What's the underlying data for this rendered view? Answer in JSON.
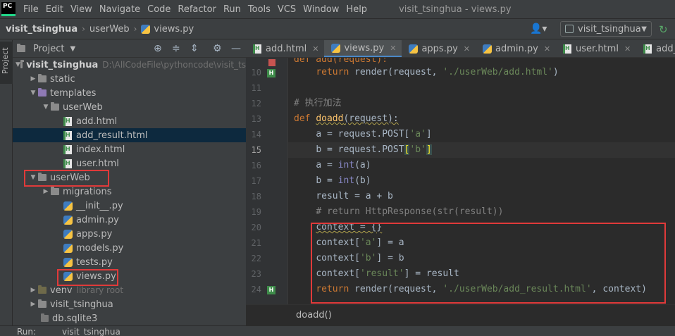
{
  "app": {
    "logo_text": "PC",
    "window_title": "visit_tsinghua - views.py"
  },
  "menu": [
    "File",
    "Edit",
    "View",
    "Navigate",
    "Code",
    "Refactor",
    "Run",
    "Tools",
    "VCS",
    "Window",
    "Help"
  ],
  "navbar": {
    "crumbs": [
      "visit_tsinghua",
      "userWeb",
      "views.py"
    ],
    "run_config": "visit_tsinghua"
  },
  "project_panel": {
    "title": "Project"
  },
  "tree": {
    "root": "visit_tsinghua",
    "root_path": "D:\\AllCodeFile\\pythoncode\\visit_ts",
    "static": "static",
    "templates": "templates",
    "tpl_userweb": "userWeb",
    "add_html": "add.html",
    "add_result_html": "add_result.html",
    "index_html": "index.html",
    "user_html": "user.html",
    "userweb": "userWeb",
    "migrations": "migrations",
    "init_py": "__init__.py",
    "admin_py": "admin.py",
    "apps_py": "apps.py",
    "models_py": "models.py",
    "tests_py": "tests.py",
    "views_py": "views.py",
    "venv": "venv",
    "venv_hint": "library root",
    "visit_pkg": "visit_tsinghua",
    "db": "db.sqlite3"
  },
  "tabs": [
    {
      "label": "add.html",
      "icon": "html"
    },
    {
      "label": "views.py",
      "icon": "py"
    },
    {
      "label": "apps.py",
      "icon": "py"
    },
    {
      "label": "admin.py",
      "icon": "py"
    },
    {
      "label": "user.html",
      "icon": "html"
    },
    {
      "label": "add_result.html",
      "icon": "html"
    }
  ],
  "code": {
    "l9": "def add(request):",
    "l10_kw": "return",
    "l10_a": " render(request, ",
    "l10_str": "'./userWeb/add.html'",
    "l10_b": ")",
    "l12": "# 执行加法",
    "l13_kw": "def",
    "l13_fn": "doadd",
    "l13_rest": "(request):",
    "l14_a": "a = request.POST[",
    "l14_str": "'a'",
    "l14_b": "]",
    "l15_a": "b = request.POST",
    "l15_ob": "[",
    "l15_str": "'b'",
    "l15_cb": "]",
    "l16_a": "a = ",
    "l16_bi": "int",
    "l16_b": "(a)",
    "l17_a": "b = ",
    "l17_bi": "int",
    "l17_b": "(b)",
    "l18": "result = a + b",
    "l19": "# return HttpResponse(str(result))",
    "l20": "context = {}",
    "l21_a": "context[",
    "l21_str": "'a'",
    "l21_b": "] = a",
    "l22_a": "context[",
    "l22_str": "'b'",
    "l22_b": "] = b",
    "l23_a": "context[",
    "l23_str": "'result'",
    "l23_b": "] = result",
    "l24_kw": "return",
    "l24_a": " render(request, ",
    "l24_str": "'./userWeb/add_result.html'",
    "l24_b": ", context)"
  },
  "line_numbers": [
    "10",
    "11",
    "12",
    "13",
    "14",
    "15",
    "16",
    "17",
    "18",
    "19",
    "20",
    "21",
    "22",
    "23",
    "24"
  ],
  "editor_footer": "doadd()",
  "run_bar": {
    "label": "Run:",
    "target": "visit_tsinghua"
  },
  "colors": {
    "highlight": "#e03a3a",
    "keyword": "#cc7832",
    "string": "#6a8759",
    "function": "#ffc66d"
  }
}
